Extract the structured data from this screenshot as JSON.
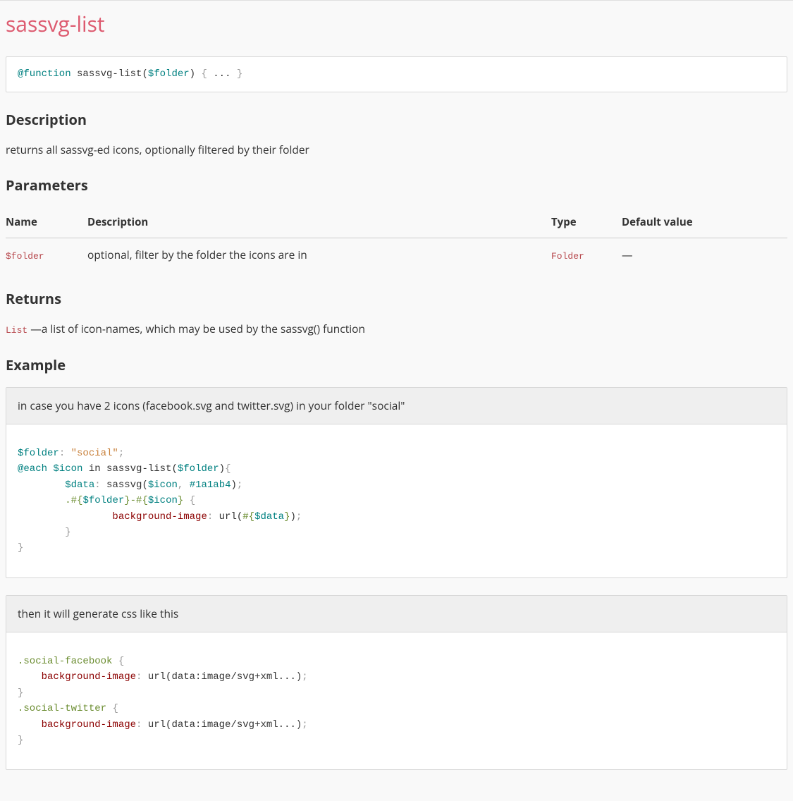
{
  "title": "sassvg-list",
  "signature_html": "<span class=\"tok-kw\">@function</span> sassvg-list(<span class=\"tok-var\">$folder</span>) <span class=\"tok-punct\">{</span> ... <span class=\"tok-punct\">}</span>",
  "sections": {
    "description_heading": "Description",
    "description_text": "returns all sassvg-ed icons, optionally filtered by their folder",
    "parameters_heading": "Parameters",
    "returns_heading": "Returns",
    "example_heading": "Example"
  },
  "param_headers": {
    "name": "Name",
    "description": "Description",
    "type": "Type",
    "default": "Default value"
  },
  "parameters": [
    {
      "name": "$folder",
      "description": "optional, filter by the folder the icons are in",
      "type": "Folder",
      "default": "—"
    }
  ],
  "returns": {
    "type": "List",
    "sep": " —",
    "text": "a list of icon-names, which may be used by the sassvg() function"
  },
  "examples": [
    {
      "caption": "in case you have 2 icons (facebook.svg and twitter.svg) in your folder \"social\"",
      "code_html": "<span class=\"tok-var\">$folder</span><span class=\"tok-punct\">:</span> <span class=\"tok-str\">\"social\"</span><span class=\"tok-punct\">;</span>\n<span class=\"tok-kw\">@each</span> <span class=\"tok-var\">$icon</span> in sassvg-list(<span class=\"tok-var\">$folder</span>)<span class=\"tok-punct\">{</span>\n        <span class=\"tok-var\">$data</span><span class=\"tok-punct\">:</span> sassvg(<span class=\"tok-var\">$icon</span><span class=\"tok-punct\">,</span> <span class=\"tok-num\">#1a1ab4</span>)<span class=\"tok-punct\">;</span>\n        <span class=\"tok-sel\">.#{</span><span class=\"tok-var\">$folder</span><span class=\"tok-sel\">}-#{</span><span class=\"tok-var\">$icon</span><span class=\"tok-sel\">}</span> <span class=\"tok-punct\">{</span>\n                <span class=\"tok-prop\">background-image</span><span class=\"tok-punct\">:</span> url(<span class=\"tok-sel\">#{</span><span class=\"tok-var\">$data</span><span class=\"tok-sel\">}</span>)<span class=\"tok-punct\">;</span>\n        <span class=\"tok-punct\">}</span>\n<span class=\"tok-punct\">}</span>"
    },
    {
      "caption": "then it will generate css like this",
      "code_html": "<span class=\"tok-class\">.social-facebook</span> <span class=\"tok-punct\">{</span>\n    <span class=\"tok-prop\">background-image</span><span class=\"tok-punct\">:</span> url(data:image/svg+xml...)<span class=\"tok-punct\">;</span>\n<span class=\"tok-punct\">}</span>\n<span class=\"tok-class\">.social-twitter</span> <span class=\"tok-punct\">{</span>\n    <span class=\"tok-prop\">background-image</span><span class=\"tok-punct\">:</span> url(data:image/svg+xml...)<span class=\"tok-punct\">;</span>\n<span class=\"tok-punct\">}</span>"
    }
  ]
}
